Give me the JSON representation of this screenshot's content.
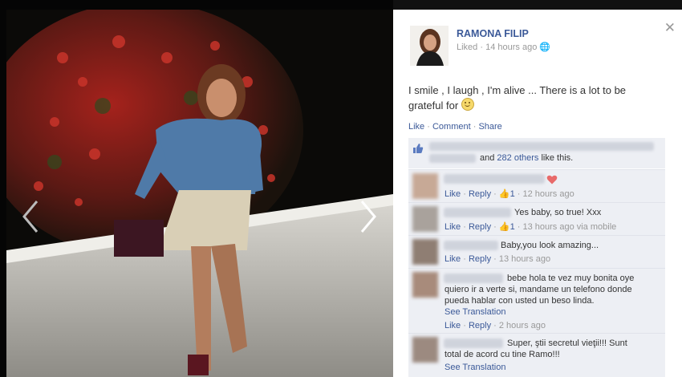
{
  "owner": {
    "name": "RAMONA FILIP",
    "liked": "Liked",
    "time": "14 hours ago",
    "privacy_icon": "globe-icon"
  },
  "caption": "I smile , I laugh , I'm alive ... There is a lot to be grateful for",
  "actions": {
    "like": "Like",
    "comment": "Comment",
    "share": "Share",
    "sep": " · "
  },
  "likes": {
    "and": "and",
    "others": "282 others",
    "suffix": "like this."
  },
  "comments": [
    {
      "text": "",
      "like": "Like",
      "reply": "Reply",
      "likes": "1",
      "time": "12 hours ago",
      "heart": true
    },
    {
      "text": "Yes baby, so true! Xxx",
      "like": "Like",
      "reply": "Reply",
      "likes": "1",
      "time": "13 hours ago via mobile"
    },
    {
      "text": "Baby,you look amazing...",
      "like": "Like",
      "reply": "Reply",
      "time": "13 hours ago"
    },
    {
      "text_line1": "bebe hola te vez muy bonita oye",
      "text_line2": "quiero ir a verte si, mandame un telefono donde",
      "text_line3": "pueda hablar con usted un beso linda.",
      "translate": "See Translation",
      "like": "Like",
      "reply": "Reply",
      "time": "2 hours ago"
    },
    {
      "text_line1": "Super, ştii secretul vieţii!!! Sunt",
      "text_line2": "total de acord cu tine Ramo!!!",
      "translate": "See Translation"
    }
  ],
  "colors": {
    "link": "#3b5998",
    "meta": "#999999",
    "comment_bg": "#edeff4"
  }
}
